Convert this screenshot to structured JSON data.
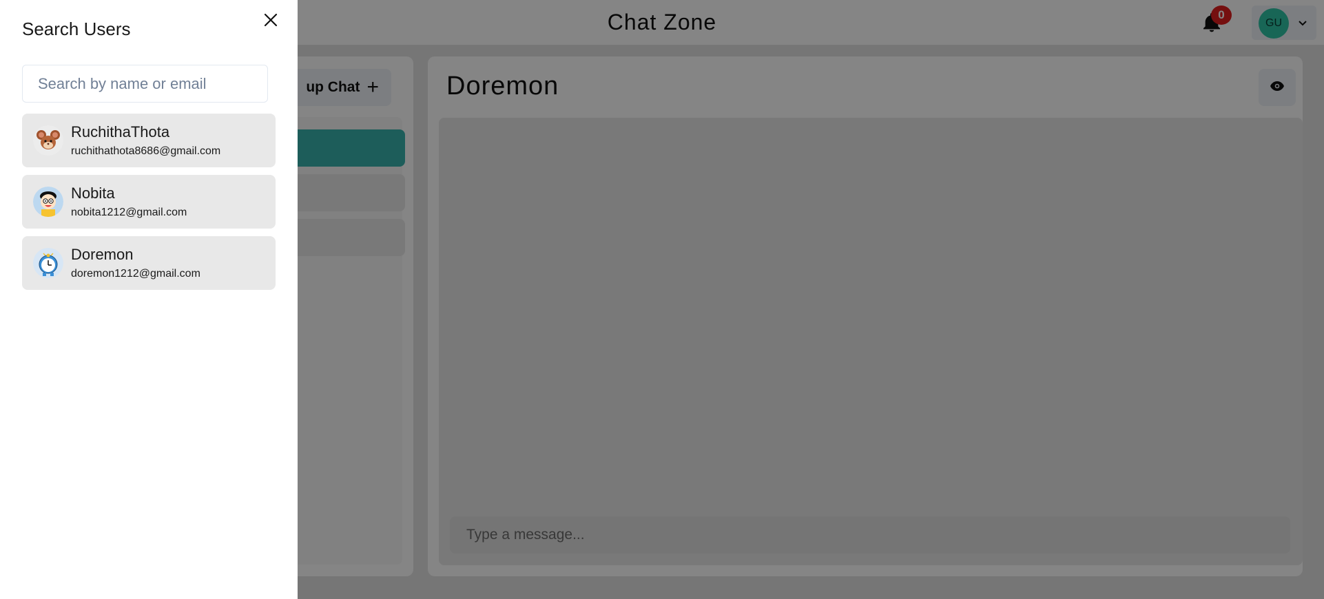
{
  "header": {
    "title": "Chat Zone",
    "notification_count": "0",
    "avatar_initials": "GU"
  },
  "chats_panel": {
    "new_group_label": "up Chat"
  },
  "chat_box": {
    "chat_name": "Doremon",
    "message_placeholder": "Type a message..."
  },
  "search_drawer": {
    "title": "Search Users",
    "search_placeholder": "Search by name or email",
    "search_value": "",
    "results": [
      {
        "name": "RuchithaThota",
        "email": "ruchithathota8686@gmail.com",
        "avatar_icon": "jerry-mouse-avatar"
      },
      {
        "name": "Nobita",
        "email": "nobita1212@gmail.com",
        "avatar_icon": "nobita-avatar"
      },
      {
        "name": "Doremon",
        "email": "doremon1212@gmail.com",
        "avatar_icon": "doraemon-clock-avatar"
      }
    ]
  },
  "colors": {
    "accent": "#38b2ac",
    "badge": "#e11d1d",
    "avatar_bg": "#2ec4a6",
    "overlay": "rgba(0,0,0,0.48)"
  }
}
